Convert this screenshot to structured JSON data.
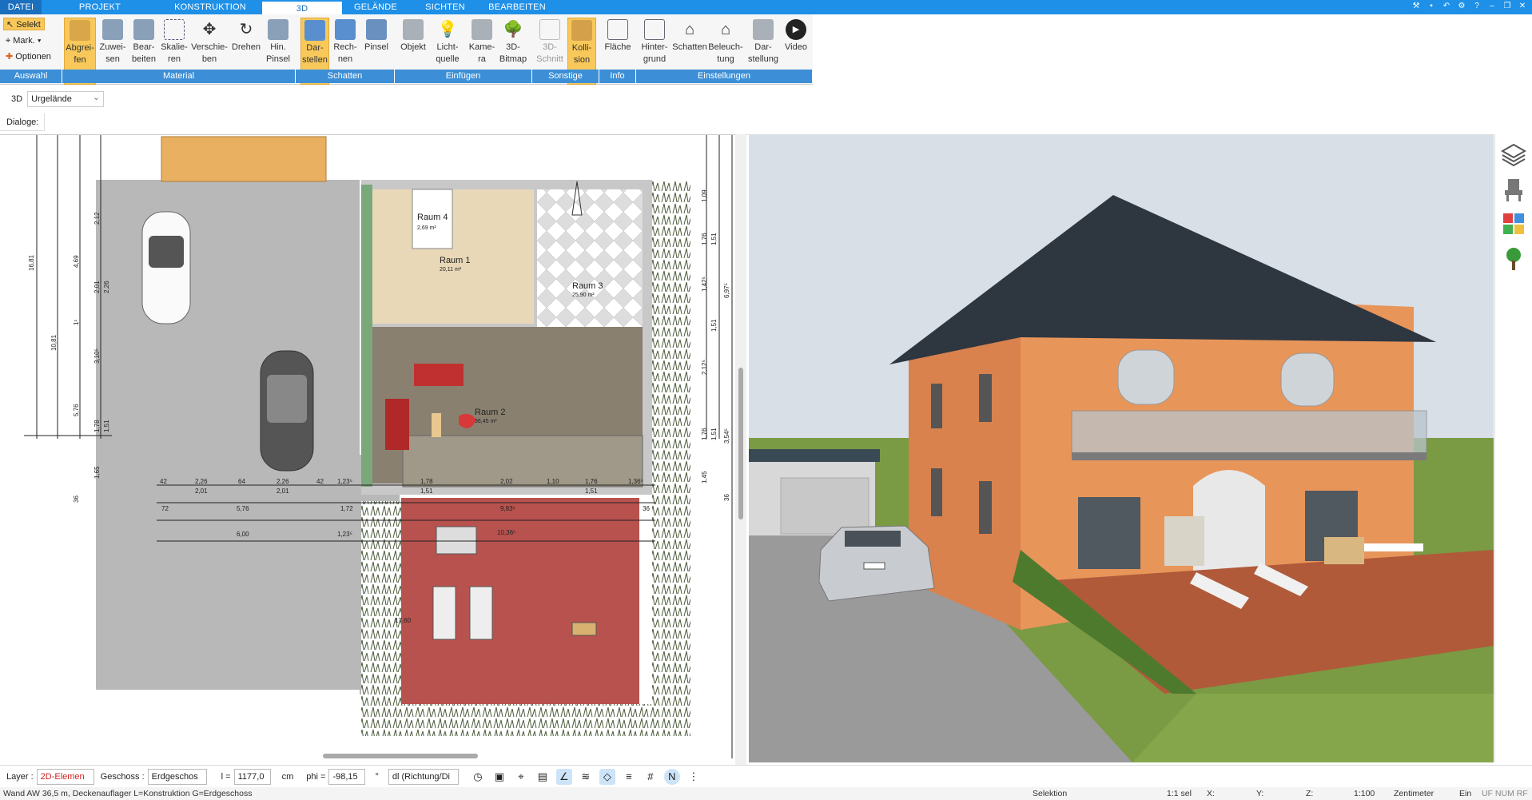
{
  "menu": {
    "tabs": [
      "DATEI",
      "PROJEKT",
      "KONSTRUKTION",
      "3D",
      "GELÄNDE",
      "SICHTEN",
      "BEARBEITEN"
    ],
    "active": "3D"
  },
  "ribbon": {
    "auswahl": {
      "selekt": "Selekt",
      "mark": "Mark.",
      "optionen": "Optionen"
    },
    "buttons": [
      {
        "l1": "Abgrei-",
        "l2": "fen"
      },
      {
        "l1": "Zuwei-",
        "l2": "sen"
      },
      {
        "l1": "Bear-",
        "l2": "beiten"
      },
      {
        "l1": "Skalie-",
        "l2": "ren"
      },
      {
        "l1": "Verschie-",
        "l2": "ben"
      },
      {
        "l1": "Drehen",
        "l2": ""
      },
      {
        "l1": "Hin.",
        "l2": "Pinsel"
      },
      {
        "l1": "Dar-",
        "l2": "stellen"
      },
      {
        "l1": "Rech-",
        "l2": "nen"
      },
      {
        "l1": "Pinsel",
        "l2": ""
      },
      {
        "l1": "Objekt",
        "l2": ""
      },
      {
        "l1": "Licht-",
        "l2": "quelle"
      },
      {
        "l1": "Kame-",
        "l2": "ra"
      },
      {
        "l1": "3D-",
        "l2": "Bitmap"
      },
      {
        "l1": "3D-",
        "l2": "Schnitt"
      },
      {
        "l1": "Kolli-",
        "l2": "sion"
      },
      {
        "l1": "Fläche",
        "l2": ""
      },
      {
        "l1": "Hinter-",
        "l2": "grund"
      },
      {
        "l1": "Schatten",
        "l2": ""
      },
      {
        "l1": "Beleuch-",
        "l2": "tung"
      },
      {
        "l1": "Dar-",
        "l2": "stellung"
      },
      {
        "l1": "Video",
        "l2": ""
      }
    ],
    "groups": [
      "Auswahl",
      "Material",
      "Schatten",
      "Einfügen",
      "Sonstige",
      "Info",
      "Einstellungen"
    ]
  },
  "viewbar": {
    "mode": "3D",
    "terrain": "Urgelände",
    "dialoge": "Dialoge:"
  },
  "plan": {
    "rooms": [
      {
        "name": "Raum 4",
        "area": "2,69 m²"
      },
      {
        "name": "Raum 1",
        "area": "20,11 m²"
      },
      {
        "name": "Raum 3",
        "area": "25,90 m²"
      },
      {
        "name": "Raum 2",
        "area": "36,45 m²"
      }
    ],
    "dims_left": [
      "16,81",
      "10,81",
      "4,69",
      "2,01",
      "2,26",
      "1¹",
      "3,10⁵",
      "5,76",
      "1,78",
      "1,51",
      "1,65",
      "2,12",
      "36"
    ],
    "dims_right": [
      "1,09",
      "1,76",
      "1,51",
      "1,42⁵",
      "1,51",
      "2,12⁵",
      "1,76",
      "1,51",
      "1,45",
      "6,97⁵",
      "3,54⁵",
      "36"
    ],
    "dims_bottom": [
      "42",
      "2,26",
      "64",
      "2,26",
      "42",
      "1,23⁵",
      "2,01",
      "2,01",
      "5,76",
      "6,00",
      "1,23⁵",
      "1,72",
      "1,78",
      "1,51",
      "2,02",
      "9,83⁵",
      "1,10",
      "1,76",
      "1,51",
      "1,36⁵",
      "10,36⁵",
      "17,60",
      "36",
      "72"
    ]
  },
  "bottom": {
    "layer_label": "Layer :",
    "layer_value": "2D-Elemen",
    "geschoss_label": "Geschoss :",
    "geschoss_value": "Erdgeschos",
    "l_label": "l =",
    "l_value": "1177,0",
    "l_unit": "cm",
    "phi_label": "phi =",
    "phi_value": "-98,15",
    "phi_unit": "°",
    "dl_value": "dl (Richtung/Di"
  },
  "status": {
    "message": "Wand AW 36,5 m, Deckenauflager L=Konstruktion G=Erdgeschoss",
    "mode": "Selektion",
    "sel": "1:1 sel",
    "x": "X:",
    "y": "Y:",
    "z": "Z:",
    "scale": "1:100",
    "unit": "Zentimeter",
    "ein": "Ein",
    "flags": "UF NUM RF"
  },
  "colors": {
    "accent": "#1e90e8",
    "ribbon_group": "#3c8fd6",
    "highlight": "#f8c95a",
    "terrace": "#b8524e",
    "house_wall": "#e8955a",
    "roof": "#2e3640"
  }
}
